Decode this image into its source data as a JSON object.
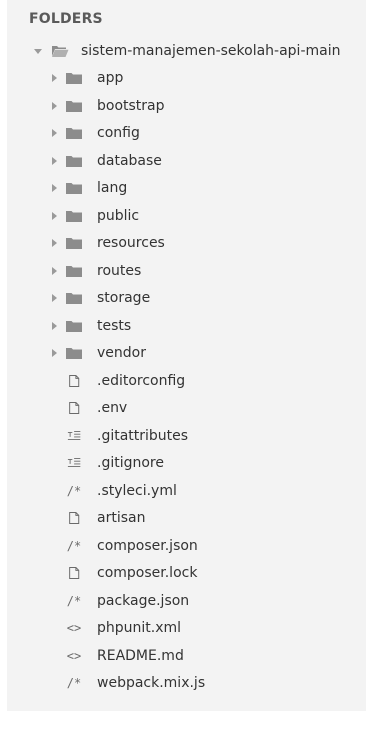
{
  "explorer": {
    "header": "FOLDERS",
    "root": {
      "label": "sistem-manajemen-sekolah-api-main",
      "expanded": true
    },
    "folders": [
      {
        "label": "app",
        "icon": "folder-icon"
      },
      {
        "label": "bootstrap",
        "icon": "folder-icon"
      },
      {
        "label": "config",
        "icon": "folder-icon"
      },
      {
        "label": "database",
        "icon": "folder-icon"
      },
      {
        "label": "lang",
        "icon": "folder-icon"
      },
      {
        "label": "public",
        "icon": "folder-icon"
      },
      {
        "label": "resources",
        "icon": "folder-icon"
      },
      {
        "label": "routes",
        "icon": "folder-icon"
      },
      {
        "label": "storage",
        "icon": "folder-icon"
      },
      {
        "label": "tests",
        "icon": "folder-icon"
      },
      {
        "label": "vendor",
        "icon": "folder-icon"
      }
    ],
    "files": [
      {
        "label": ".editorconfig",
        "icon": "file-icon"
      },
      {
        "label": ".env",
        "icon": "file-icon"
      },
      {
        "label": ".gitattributes",
        "icon": "git-file-icon"
      },
      {
        "label": ".gitignore",
        "icon": "git-file-icon"
      },
      {
        "label": ".styleci.yml",
        "icon": "code-comment-icon"
      },
      {
        "label": "artisan",
        "icon": "file-icon"
      },
      {
        "label": "composer.json",
        "icon": "code-comment-icon"
      },
      {
        "label": "composer.lock",
        "icon": "file-icon"
      },
      {
        "label": "package.json",
        "icon": "code-comment-icon"
      },
      {
        "label": "phpunit.xml",
        "icon": "markup-icon"
      },
      {
        "label": "README.md",
        "icon": "markup-icon"
      },
      {
        "label": "webpack.mix.js",
        "icon": "code-comment-icon"
      }
    ]
  },
  "colors": {
    "sidebar_bg": "#f3f3f3",
    "folder_fill": "#8c8c8c",
    "text": "#333333",
    "header_text": "#5a5a5a"
  }
}
